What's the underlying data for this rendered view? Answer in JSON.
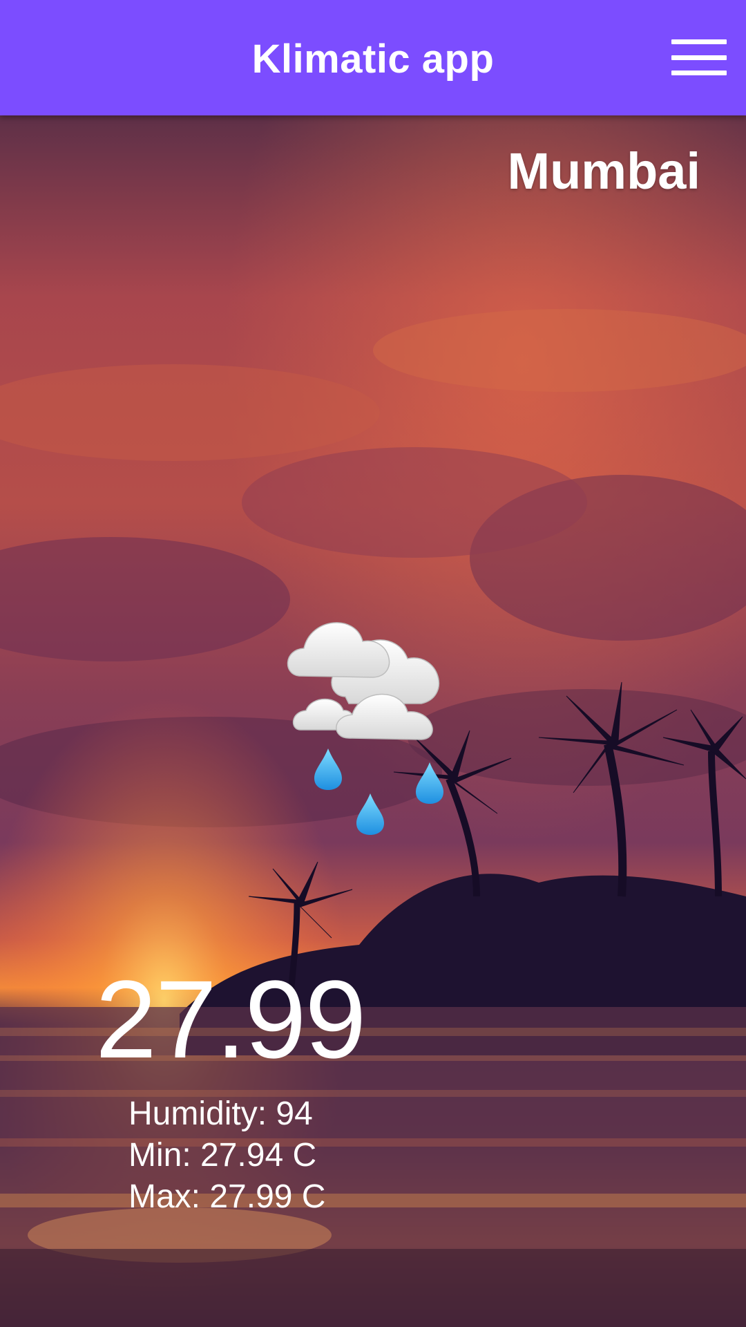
{
  "app_bar": {
    "title": "Klimatic app",
    "menu_icon": "hamburger-menu-icon",
    "color": "#7c4dff"
  },
  "weather": {
    "city": "Mumbai",
    "condition_icon": "rain-cloud-icon",
    "temperature": "27.99",
    "humidity": "Humidity: 94",
    "min": "Min: 27.94 C",
    "max": "Max: 27.99 C"
  },
  "background": {
    "scene": "sunset-beach-palm-trees"
  }
}
